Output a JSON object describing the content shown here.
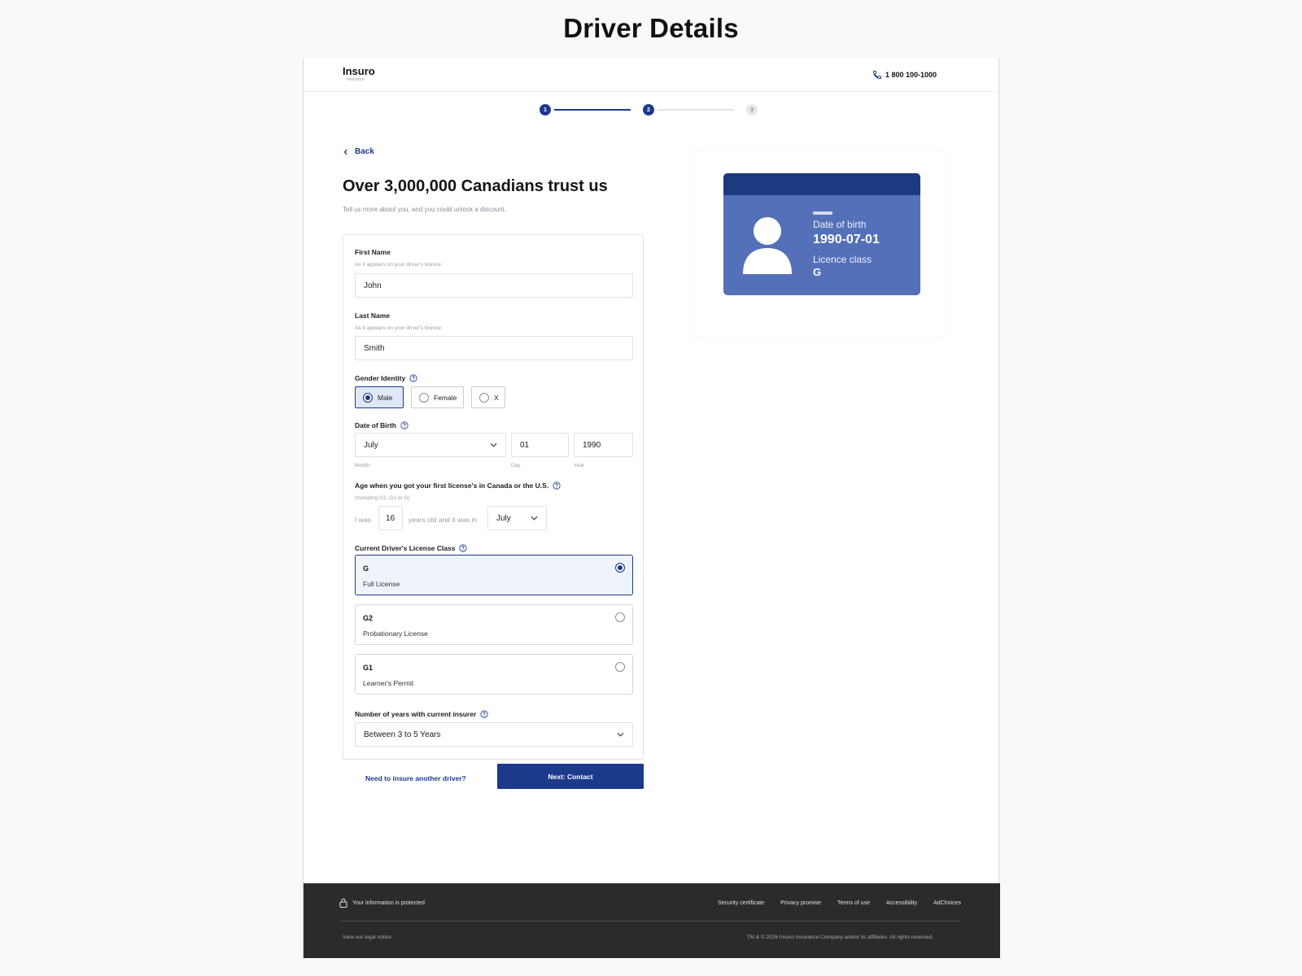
{
  "page_heading": "Driver Details",
  "header": {
    "logo_name": "Insuro",
    "logo_sub": "Insurance",
    "phone": "1 800 100-1000"
  },
  "stepper": {
    "steps": [
      {
        "label": "1",
        "state": "done"
      },
      {
        "label": "2",
        "state": "done"
      },
      {
        "label": "3",
        "state": "todo"
      }
    ],
    "accent": "#1c3a8c"
  },
  "back_label": "Back",
  "headline": "Over 3,000,000 Canadians trust us",
  "subline": "Tell us more about you, and you could unlock a discount.",
  "form": {
    "first_name": {
      "label": "First Name",
      "hint": "As it appears on your driver's licence",
      "value": "John"
    },
    "last_name": {
      "label": "Last Name",
      "hint": "As it appears on your driver's licence",
      "value": "Smith"
    },
    "gender": {
      "label": "Gender Identity",
      "options": [
        {
          "label": "Male",
          "selected": true
        },
        {
          "label": "Female",
          "selected": false
        },
        {
          "label": "X",
          "selected": false
        }
      ]
    },
    "dob": {
      "label": "Date of Birth",
      "month": "July",
      "day": "01",
      "year": "1990",
      "month_label": "Month",
      "day_label": "Day",
      "year_label": "Year"
    },
    "first_licence": {
      "label": "Age when you got your first license's in Canada or the U.S.",
      "hint": "(Including G1, G2 or G)",
      "prefix": "I was",
      "age": "16",
      "middle": "years old and it was in",
      "month": "July"
    },
    "licence_class": {
      "label": "Current Driver's License Class",
      "options": [
        {
          "code": "G",
          "desc": "Full License",
          "selected": true
        },
        {
          "code": "G2",
          "desc": "Probationary License",
          "selected": false
        },
        {
          "code": "G1",
          "desc": "Learner's Permit",
          "selected": false
        }
      ]
    },
    "years_insurer": {
      "label": "Number of years with current insurer",
      "value": "Between 3 to 5 Years"
    }
  },
  "another_driver_link": "Need to insure another driver?",
  "next_button": "Next: Contact",
  "licence_card": {
    "dob_title": "Date of birth",
    "dob_value": "1990-07-01",
    "class_title": "Licence class",
    "class_value": "G"
  },
  "footer": {
    "protected": "Your information is protected",
    "links": [
      "Security certificate",
      "Privacy promise",
      "Terms of use",
      "Accessibility",
      "AdChoices"
    ],
    "legal": "View our legal notice",
    "copyright": "TM & © 2026 Insuro Insurance Company and/or its affiliates. All rights reserved."
  }
}
